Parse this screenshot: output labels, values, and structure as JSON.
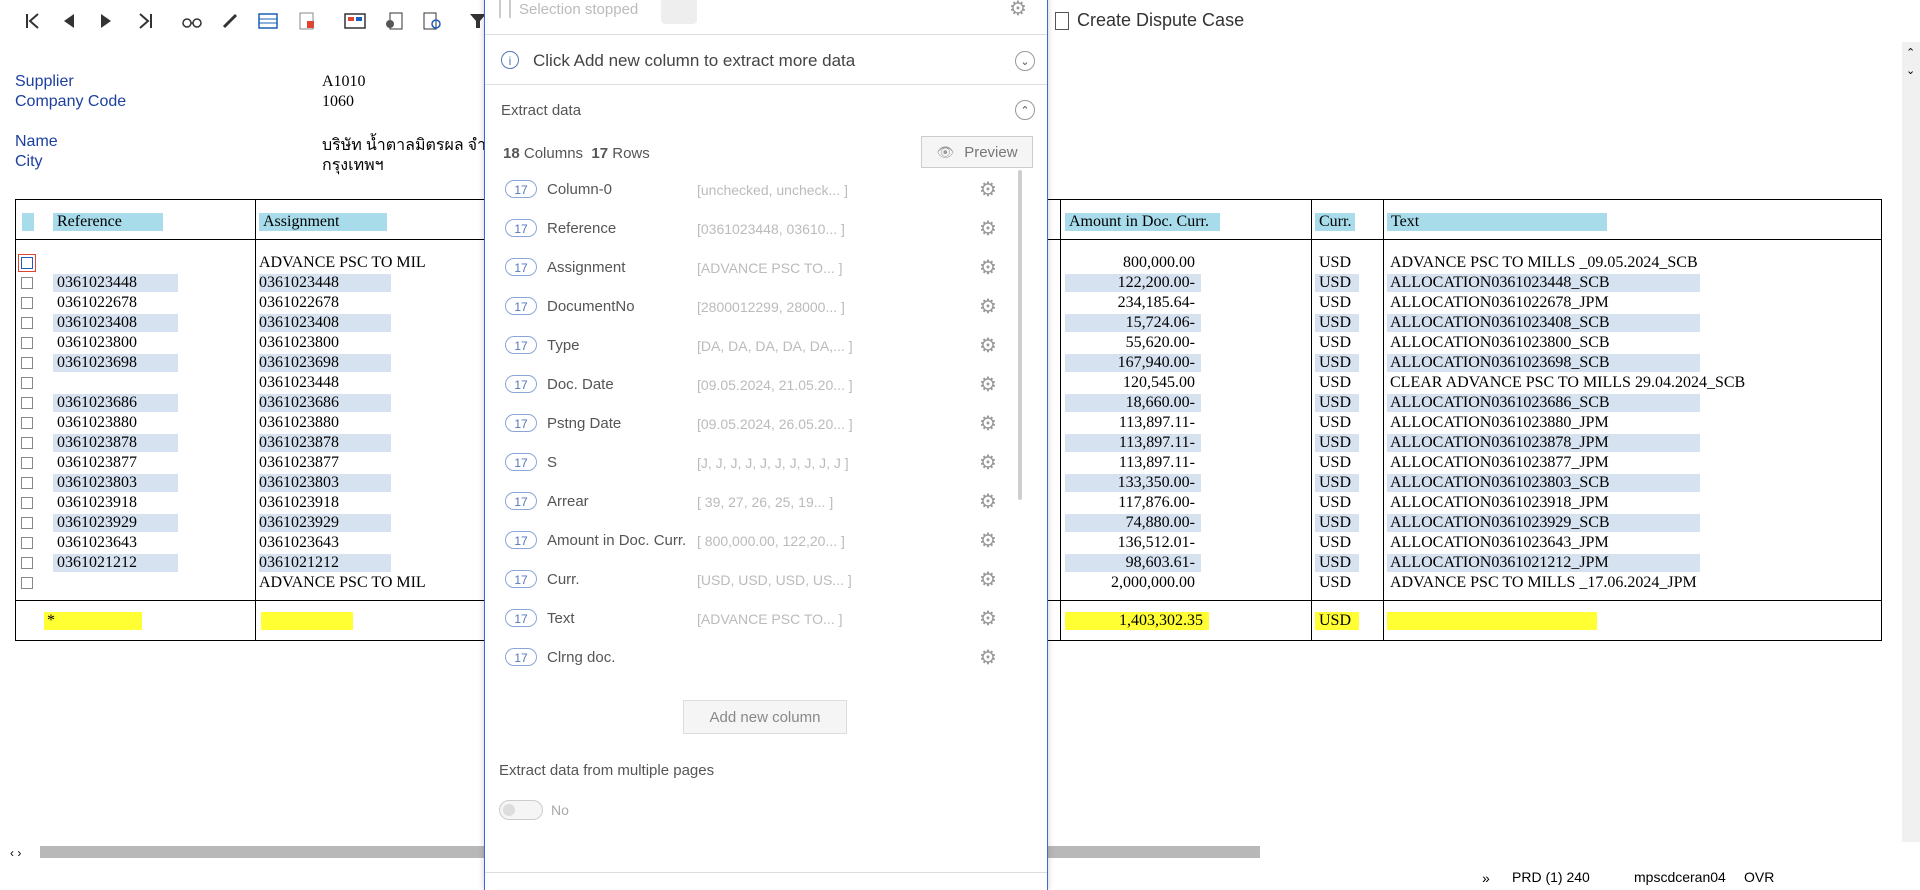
{
  "toolbar": {
    "icons": [
      "first-page-icon",
      "prev-page-icon",
      "next-page-icon",
      "last-page-icon",
      "glasses-icon",
      "pencil-icon",
      "table-icon",
      "doc-red-icon",
      "layout-icon",
      "doc-gear-icon",
      "web-doc-icon",
      "filter-icon"
    ],
    "dispute_label": "Create Dispute Case"
  },
  "header": {
    "supplier_label": "Supplier",
    "supplier_value": "A1010",
    "company_label": "Company Code",
    "company_value": "1060",
    "name_label": "Name",
    "name_value": "บริษัท น้ำตาลมิตรผล จำ",
    "city_label": "City",
    "city_value": "กรุงเทพฯ"
  },
  "table": {
    "columns": {
      "reference": "Reference",
      "assignment": "Assignment",
      "amount": "Amount in Doc. Curr.",
      "curr": "Curr.",
      "text": "Text"
    },
    "rows": [
      {
        "reference": "",
        "assignment": "ADVANCE PSC TO MIL",
        "amount": "800,000.00",
        "curr": "USD",
        "text": "ADVANCE PSC TO MILLS _09.05.2024_SCB",
        "hl": false
      },
      {
        "reference": "0361023448",
        "assignment": "0361023448",
        "amount": "122,200.00-",
        "curr": "USD",
        "text": "ALLOCATION0361023448_SCB",
        "hl": true
      },
      {
        "reference": "0361022678",
        "assignment": "0361022678",
        "amount": "234,185.64-",
        "curr": "USD",
        "text": "ALLOCATION0361022678_JPM",
        "hl": false
      },
      {
        "reference": "0361023408",
        "assignment": "0361023408",
        "amount": "15,724.06-",
        "curr": "USD",
        "text": "ALLOCATION0361023408_SCB",
        "hl": true
      },
      {
        "reference": "0361023800",
        "assignment": "0361023800",
        "amount": "55,620.00-",
        "curr": "USD",
        "text": "ALLOCATION0361023800_SCB",
        "hl": false
      },
      {
        "reference": "0361023698",
        "assignment": "0361023698",
        "amount": "167,940.00-",
        "curr": "USD",
        "text": "ALLOCATION0361023698_SCB",
        "hl": true
      },
      {
        "reference": "",
        "assignment": "0361023448",
        "amount": "120,545.00",
        "curr": "USD",
        "text": "CLEAR ADVANCE PSC TO MILLS 29.04.2024_SCB",
        "hl": false
      },
      {
        "reference": "0361023686",
        "assignment": "0361023686",
        "amount": "18,660.00-",
        "curr": "USD",
        "text": "ALLOCATION0361023686_SCB",
        "hl": true
      },
      {
        "reference": "0361023880",
        "assignment": "0361023880",
        "amount": "113,897.11-",
        "curr": "USD",
        "text": "ALLOCATION0361023880_JPM",
        "hl": false
      },
      {
        "reference": "0361023878",
        "assignment": "0361023878",
        "amount": "113,897.11-",
        "curr": "USD",
        "text": "ALLOCATION0361023878_JPM",
        "hl": true
      },
      {
        "reference": "0361023877",
        "assignment": "0361023877",
        "amount": "113,897.11-",
        "curr": "USD",
        "text": "ALLOCATION0361023877_JPM",
        "hl": false
      },
      {
        "reference": "0361023803",
        "assignment": "0361023803",
        "amount": "133,350.00-",
        "curr": "USD",
        "text": "ALLOCATION0361023803_SCB",
        "hl": true
      },
      {
        "reference": "0361023918",
        "assignment": "0361023918",
        "amount": "117,876.00-",
        "curr": "USD",
        "text": "ALLOCATION0361023918_JPM",
        "hl": false
      },
      {
        "reference": "0361023929",
        "assignment": "0361023929",
        "amount": "74,880.00-",
        "curr": "USD",
        "text": "ALLOCATION0361023929_SCB",
        "hl": true
      },
      {
        "reference": "0361023643",
        "assignment": "0361023643",
        "amount": "136,512.01-",
        "curr": "USD",
        "text": "ALLOCATION0361023643_JPM",
        "hl": false
      },
      {
        "reference": "0361021212",
        "assignment": "0361021212",
        "amount": "98,603.61-",
        "curr": "USD",
        "text": "ALLOCATION0361021212_JPM",
        "hl": true
      },
      {
        "reference": "",
        "assignment": "ADVANCE PSC TO MIL",
        "amount": "2,000,000.00",
        "curr": "USD",
        "text": "ADVANCE PSC TO MILLS _17.06.2024_JPM",
        "hl": false
      }
    ],
    "total": {
      "reference": "*",
      "amount": "1,403,302.35",
      "curr": "USD"
    }
  },
  "panel": {
    "selection_status": "Selection stopped",
    "hint": "Click Add new column to extract more data",
    "extract_title": "Extract data",
    "columns_count": "18",
    "columns_label": "Columns",
    "rows_count": "17",
    "rows_label": "Rows",
    "preview_label": "Preview",
    "columns": [
      {
        "count": "17",
        "name": "Column-0",
        "values": "[unchecked, uncheck... ]"
      },
      {
        "count": "17",
        "name": "Reference",
        "values": "[0361023448, 03610... ]"
      },
      {
        "count": "17",
        "name": "Assignment",
        "values": "[ADVANCE PSC TO... ]"
      },
      {
        "count": "17",
        "name": "DocumentNo",
        "values": "[2800012299, 28000... ]"
      },
      {
        "count": "17",
        "name": "Type",
        "values": "[DA, DA, DA, DA, DA,... ]"
      },
      {
        "count": "17",
        "name": "Doc. Date",
        "values": "[09.05.2024, 21.05.20... ]"
      },
      {
        "count": "17",
        "name": "Pstng Date",
        "values": "[09.05.2024, 26.05.20... ]"
      },
      {
        "count": "17",
        "name": "S",
        "values": "[J, J, J, J, J, J, J, J, J, J ]"
      },
      {
        "count": "17",
        "name": "Arrear",
        "values": "[ 39,  27,  26,  25,  19... ]"
      },
      {
        "count": "17",
        "name": "Amount in Doc. Curr.",
        "values": "[ 800,000.00,  122,20... ]"
      },
      {
        "count": "17",
        "name": "Curr.",
        "values": "[USD, USD, USD, US... ]"
      },
      {
        "count": "17",
        "name": "Text",
        "values": "[ADVANCE PSC TO... ]"
      },
      {
        "count": "17",
        "name": "Clrng doc.",
        "values": ""
      }
    ],
    "add_column_label": "Add new column",
    "multipage_label": "Extract data from multiple pages",
    "toggle_label": "No"
  },
  "status": {
    "system": "PRD (1) 240",
    "server": "mpscdceran04",
    "mode": "OVR"
  }
}
